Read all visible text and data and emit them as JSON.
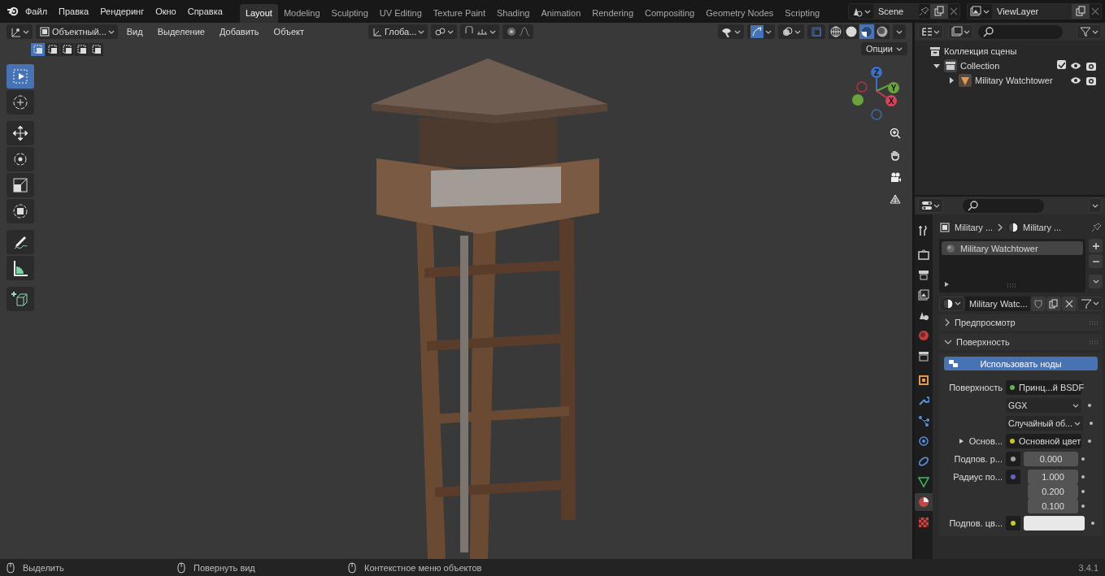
{
  "menus": [
    "Файл",
    "Правка",
    "Рендеринг",
    "Окно",
    "Справка"
  ],
  "workspaces": [
    {
      "label": "Layout",
      "selected": true
    },
    {
      "label": "Modeling",
      "selected": false
    },
    {
      "label": "Sculpting",
      "selected": false
    },
    {
      "label": "UV Editing",
      "selected": false
    },
    {
      "label": "Texture Paint",
      "selected": false
    },
    {
      "label": "Shading",
      "selected": false
    },
    {
      "label": "Animation",
      "selected": false
    },
    {
      "label": "Rendering",
      "selected": false
    },
    {
      "label": "Compositing",
      "selected": false
    },
    {
      "label": "Geometry Nodes",
      "selected": false
    },
    {
      "label": "Scripting",
      "selected": false
    }
  ],
  "scene": "Scene",
  "view_layer": "ViewLayer",
  "viewport": {
    "mode": "Объектный...",
    "menus": [
      "Вид",
      "Выделение",
      "Добавить",
      "Объект"
    ],
    "orientation": "Глоба...",
    "options": "Опции",
    "select_modes": [
      {
        "selected": true
      },
      {
        "selected": false
      },
      {
        "selected": false
      },
      {
        "selected": false
      },
      {
        "selected": false
      }
    ],
    "gizmos_on": true,
    "shading": [
      {
        "kind": "wire",
        "selected": false
      },
      {
        "kind": "solid",
        "selected": false
      },
      {
        "kind": "material",
        "selected": true
      },
      {
        "kind": "render",
        "selected": false
      }
    ],
    "tools": [
      {
        "kind": "select",
        "selected": true
      },
      {
        "kind": "cursor",
        "selected": false
      },
      {
        "kind": "move",
        "selected": false
      },
      {
        "kind": "rotate",
        "selected": false
      },
      {
        "kind": "scale",
        "selected": false
      },
      {
        "kind": "transform",
        "selected": false
      },
      {
        "kind": "annotate",
        "selected": false
      },
      {
        "kind": "measure",
        "selected": false
      },
      {
        "kind": "add-cube",
        "selected": false
      }
    ],
    "axes": [
      "Z",
      "Y",
      "X"
    ]
  },
  "outliner": {
    "root": "Коллекция сцены",
    "items": [
      {
        "label": "Collection",
        "expanded": true,
        "checked": true,
        "children": [
          {
            "label": "Military Watchtower",
            "expanded": false
          }
        ]
      }
    ]
  },
  "properties": {
    "tabs": [
      {
        "kind": "tool",
        "selected": false
      },
      {
        "kind": "render",
        "selected": false
      },
      {
        "kind": "output",
        "selected": false
      },
      {
        "kind": "view-layer",
        "selected": false
      },
      {
        "kind": "scene",
        "selected": false
      },
      {
        "kind": "world",
        "selected": false
      },
      {
        "kind": "collection",
        "selected": false
      },
      {
        "kind": "object",
        "selected": false
      },
      {
        "kind": "modifier",
        "selected": false
      },
      {
        "kind": "particles",
        "selected": false
      },
      {
        "kind": "physics",
        "selected": false
      },
      {
        "kind": "constraints",
        "selected": false
      },
      {
        "kind": "data",
        "selected": false
      },
      {
        "kind": "material",
        "selected": true
      },
      {
        "kind": "texture",
        "selected": false
      }
    ],
    "breadcrumb": [
      "Military ...",
      "Military ..."
    ],
    "slots": [
      {
        "label": "Military Watchtower",
        "selected": true
      }
    ],
    "material": "Military Watc...",
    "panels": [
      {
        "label": "Предпросмотр",
        "expanded": false
      },
      {
        "label": "Поверхность",
        "expanded": true
      }
    ],
    "use_nodes": "Использовать ноды",
    "fields": [
      {
        "kind": "socket",
        "label": "Поверхность",
        "value": "Принц...й BSDF",
        "color": "#62b44c"
      },
      {
        "kind": "dropdown",
        "value": "GGX"
      },
      {
        "kind": "dropdown",
        "value": "Случайный об..."
      },
      {
        "kind": "link",
        "label": "Основ...",
        "value": "Основной цвет",
        "color": "#c7c729"
      },
      {
        "kind": "number",
        "label": "Подпов. р...",
        "values": [
          "0.000"
        ],
        "color": "#a1a1a1"
      },
      {
        "kind": "number",
        "label": "Радиус по...",
        "values": [
          "1.000",
          "0.200",
          "0.100"
        ],
        "color": "#6363c7"
      },
      {
        "kind": "color",
        "label": "Подпов. цв...",
        "color": "#c7c729",
        "swatch": {
          "color": "#e8e8e8"
        }
      }
    ]
  },
  "status": [
    "Выделить",
    "Повернуть вид",
    "Контекстное меню объектов"
  ],
  "version": "3.4.1"
}
